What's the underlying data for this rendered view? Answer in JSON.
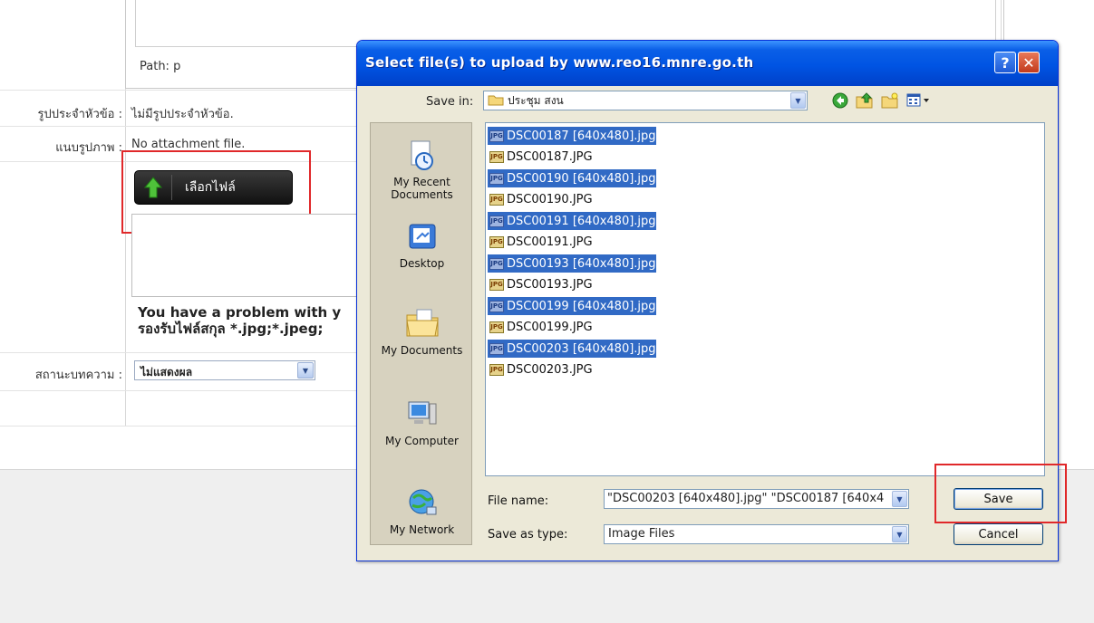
{
  "page": {
    "path_label": "Path: p",
    "rows": [
      {
        "label": "รูปประจำหัวข้อ :",
        "value": "ไม่มีรูปประจำหัวข้อ."
      },
      {
        "label": "แนบรูปภาพ :",
        "value": "No attachment file."
      }
    ],
    "choose_file_button": "เลือกไฟล์",
    "problem_line1": "You have a problem with y",
    "problem_line2": "รองรับไฟล์สกุล *.jpg;*.jpeg;",
    "status_label": "สถานะบทความ :",
    "status_value": "ไม่แสดงผล"
  },
  "dialog": {
    "title": "Select file(s) to upload by www.reo16.mnre.go.th",
    "help_glyph": "?",
    "close_glyph": "✕",
    "save_in_label": "Save in:",
    "save_in_value": "ประชุม สงน",
    "places": [
      {
        "label": "My Recent Documents",
        "icon": "recent-documents-icon"
      },
      {
        "label": "Desktop",
        "icon": "desktop-icon"
      },
      {
        "label": "My Documents",
        "icon": "my-documents-icon"
      },
      {
        "label": "My Computer",
        "icon": "my-computer-icon"
      },
      {
        "label": "My Network",
        "icon": "my-network-icon"
      }
    ],
    "files": [
      {
        "name": "DSC00187 [640x480].jpg",
        "selected": true
      },
      {
        "name": "DSC00187.JPG",
        "selected": false
      },
      {
        "name": "DSC00190 [640x480].jpg",
        "selected": true
      },
      {
        "name": "DSC00190.JPG",
        "selected": false
      },
      {
        "name": "DSC00191 [640x480].jpg",
        "selected": true
      },
      {
        "name": "DSC00191.JPG",
        "selected": false
      },
      {
        "name": "DSC00193 [640x480].jpg",
        "selected": true
      },
      {
        "name": "DSC00193.JPG",
        "selected": false
      },
      {
        "name": "DSC00199 [640x480].jpg",
        "selected": true
      },
      {
        "name": "DSC00199.JPG",
        "selected": false
      },
      {
        "name": "DSC00203 [640x480].jpg",
        "selected": true
      },
      {
        "name": "DSC00203.JPG",
        "selected": false
      }
    ],
    "file_name_label": "File name:",
    "file_name_value": "\"DSC00203 [640x480].jpg\" \"DSC00187 [640x4",
    "save_as_type_label": "Save as type:",
    "save_as_type_value": "Image Files",
    "save_button": "Save",
    "cancel_button": "Cancel"
  },
  "colors": {
    "selection": "#316ac5",
    "titlebar": "#0054e3",
    "highlight_box": "#e0282a",
    "dialog_face": "#ece9d8"
  }
}
